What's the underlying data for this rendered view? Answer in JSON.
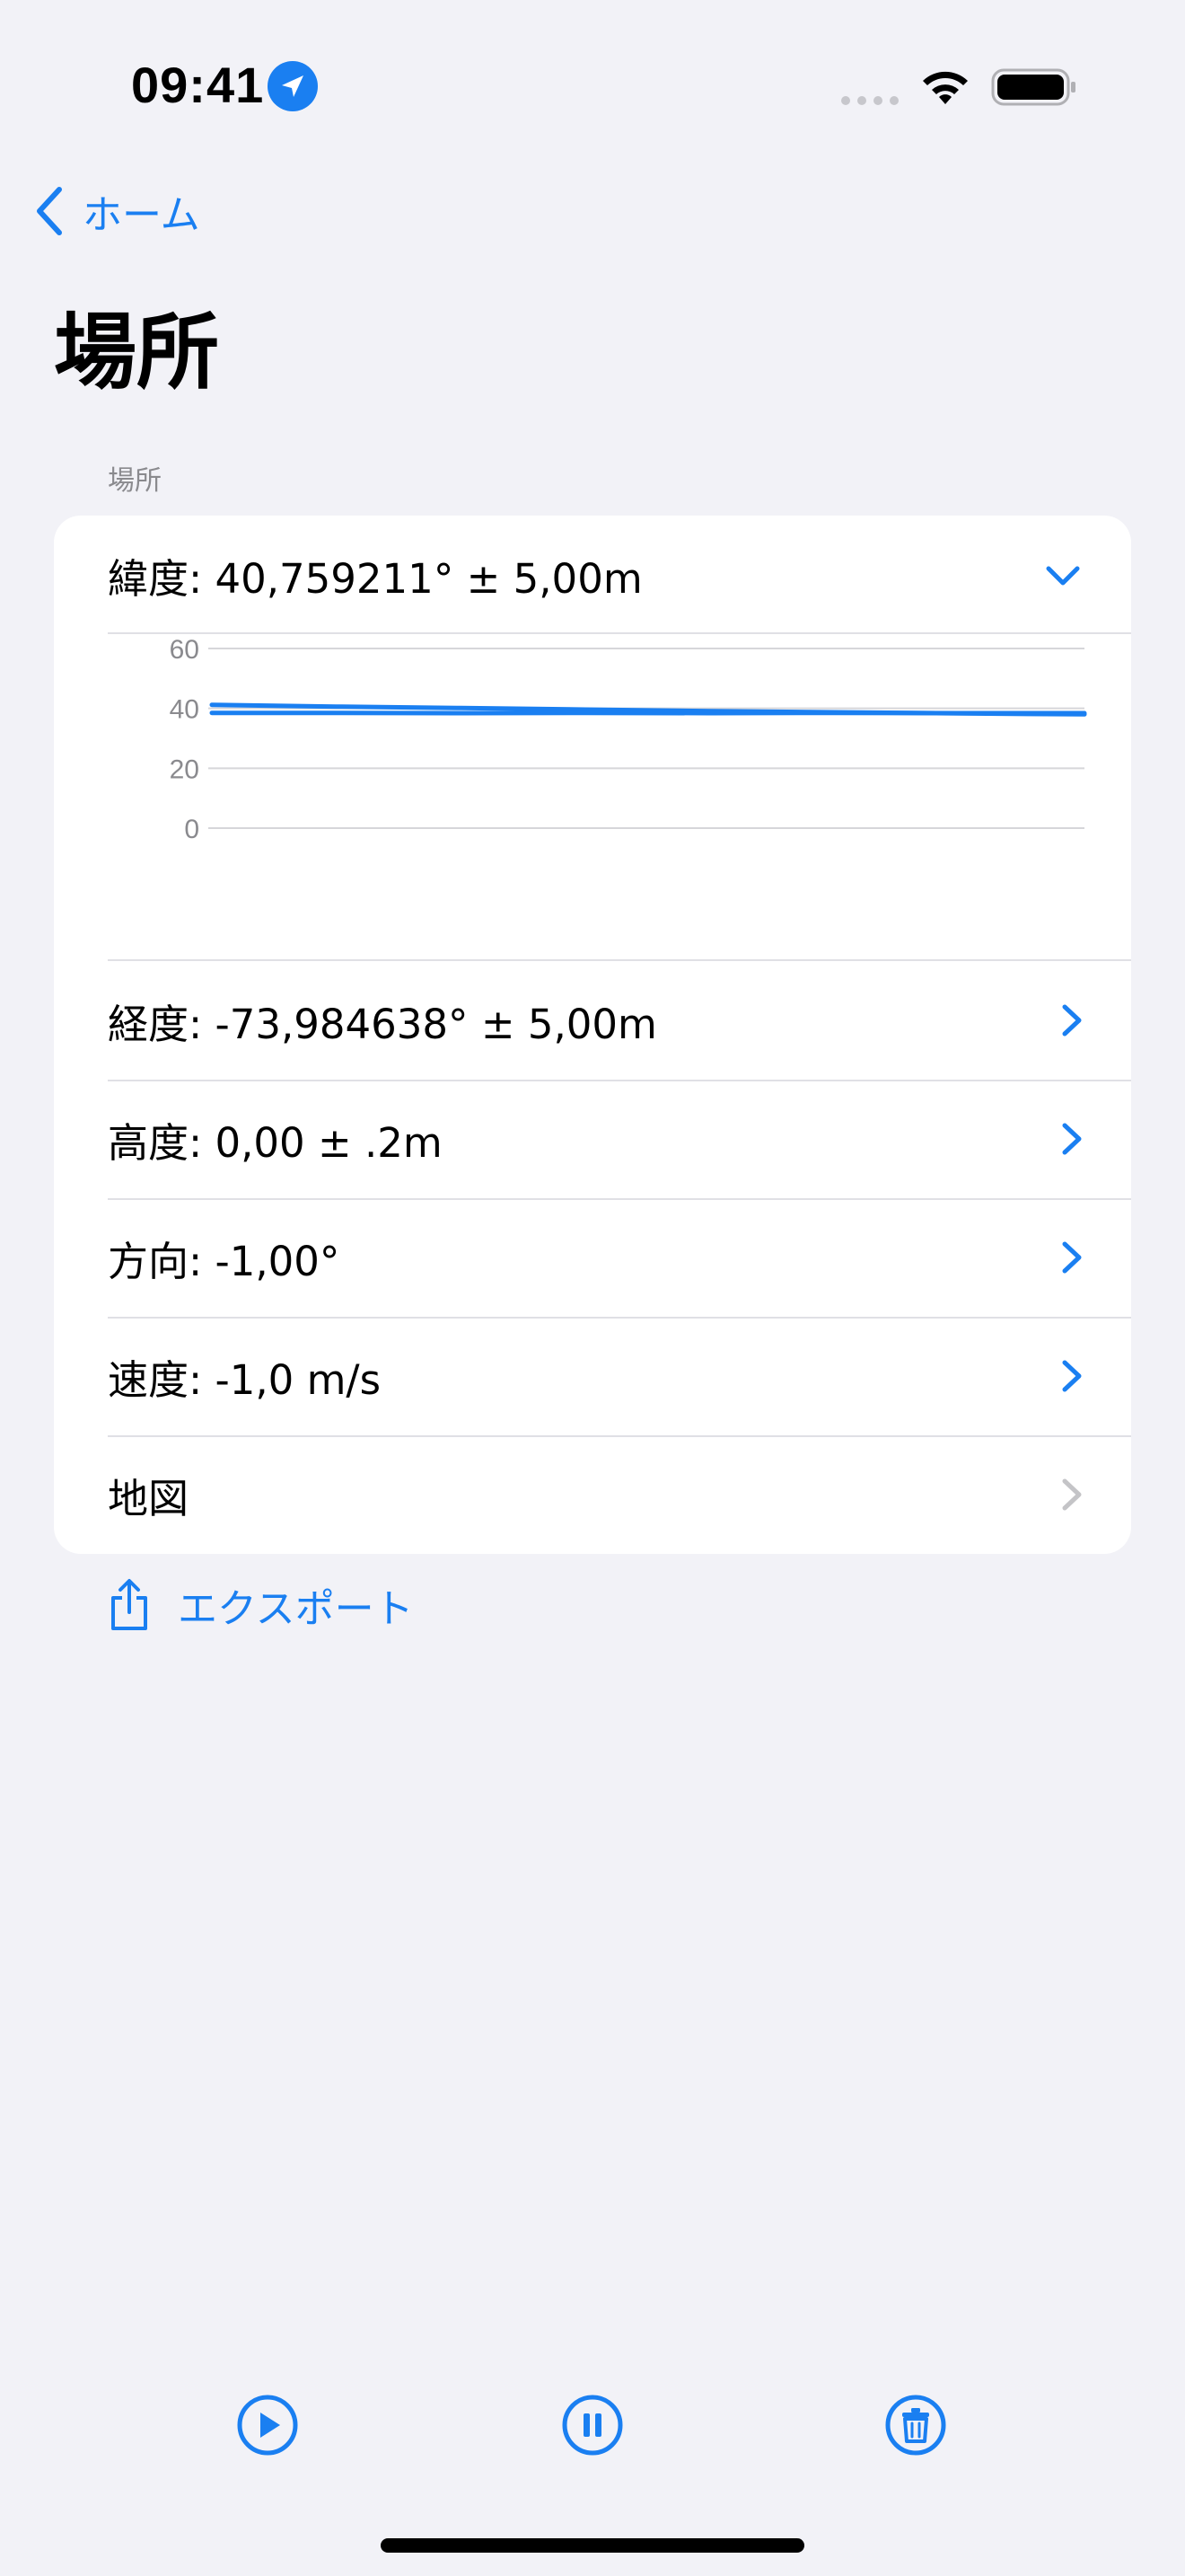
{
  "status_bar": {
    "time": "09:41",
    "location_icon": "location-arrow-icon",
    "signal_icon": "cellular-signal-icon",
    "wifi_icon": "wifi-icon",
    "battery_icon": "battery-full-icon"
  },
  "nav": {
    "back_label": "ホーム",
    "title": "場所"
  },
  "section": {
    "header": "場所"
  },
  "rows": {
    "latitude": "緯度: 40,759211° ± 5,00m",
    "longitude": "経度: -73,984638° ± 5,00m",
    "altitude": "高度: 0,00 ± .2m",
    "heading": "方向: -1,00°",
    "speed": "速度: -1,0 m/s",
    "map": "地図"
  },
  "chart_data": {
    "type": "line",
    "title": "",
    "xlabel": "",
    "ylabel": "",
    "ylim": [
      0,
      60
    ],
    "y_ticks": [
      "60",
      "40",
      "20",
      "0"
    ],
    "grid": true,
    "series": [
      {
        "values": [
          41.2,
          40.6,
          40.1,
          39.6,
          39.1,
          38.7,
          38.3,
          38.0
        ]
      },
      {
        "values": [
          38.5,
          38.5,
          38.4,
          38.5,
          38.4,
          38.5,
          38.4,
          38.4
        ]
      }
    ]
  },
  "export": {
    "label": "エクスポート",
    "icon": "share-icon"
  },
  "toolbar": {
    "play_icon": "play-icon",
    "pause_icon": "pause-icon",
    "trash_icon": "trash-icon"
  },
  "colors": {
    "accent": "#1a7ff1",
    "background": "#f2f2f7",
    "card": "#ffffff",
    "secondary_text": "#8a8a8e",
    "chart_line": "#1a7ff1",
    "disabled_chevron": "#c4c4c7"
  }
}
